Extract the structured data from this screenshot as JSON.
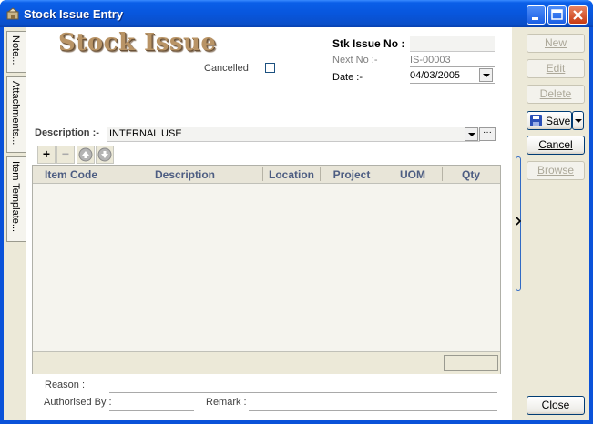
{
  "window": {
    "title": "Stock Issue Entry"
  },
  "side_tabs": [
    {
      "label": "Note..."
    },
    {
      "label": "Attachments..."
    },
    {
      "label": "Item Template..."
    }
  ],
  "form": {
    "heading": "Stock Issue",
    "cancelled_label": "Cancelled",
    "cancelled_checked": false,
    "stk_issue_no_label": "Stk Issue No :",
    "stk_issue_no_value": "",
    "next_no_label": "Next No :-",
    "next_no_value": "IS-00003",
    "date_label": "Date :-",
    "date_value": "04/03/2005",
    "description_label": "Description :-",
    "description_value": "INTERNAL USE",
    "ellipsis": "···"
  },
  "toolbar": {
    "add_symbol": "+",
    "remove_symbol": "−"
  },
  "grid": {
    "columns": [
      "Item Code",
      "Description",
      "Location",
      "Project",
      "UOM",
      "Qty"
    ],
    "rows": []
  },
  "footer": {
    "reason_label": "Reason :",
    "authorised_by_label": "Authorised By :",
    "remark_label": "Remark :"
  },
  "actions": {
    "new": "New",
    "edit": "Edit",
    "delete": "Delete",
    "save": "Save",
    "cancel": "Cancel",
    "browse": "Browse",
    "close": "Close"
  },
  "colors": {
    "title_bar": "#0A52D9",
    "heading": "#B99466",
    "grid_header_text": "#4D5D82",
    "panel": "#ECE9D8"
  }
}
